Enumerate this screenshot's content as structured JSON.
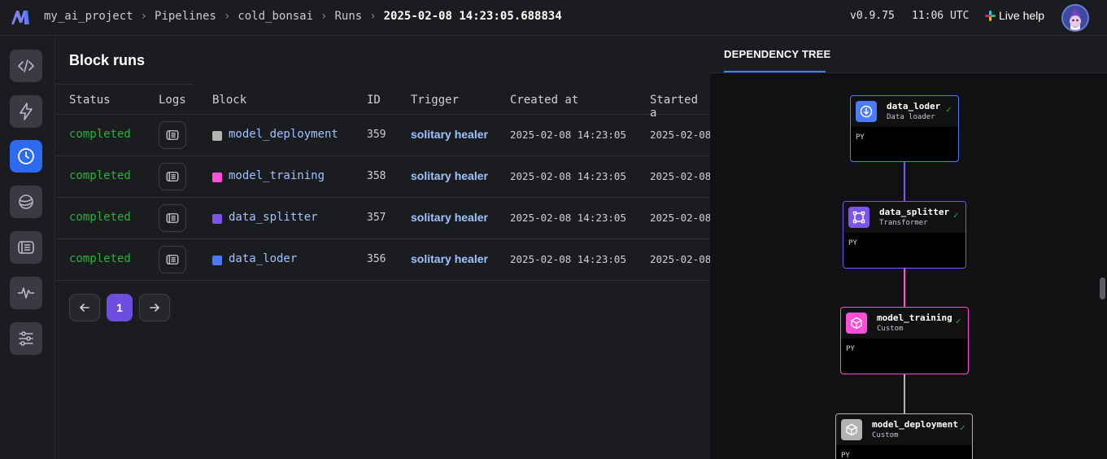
{
  "header": {
    "breadcrumbs": [
      "my_ai_project",
      "Pipelines",
      "cold_bonsai",
      "Runs"
    ],
    "current": "2025-02-08 14:23:05.688834",
    "version": "v0.9.75",
    "time": "11:06 UTC",
    "live_help": "Live help"
  },
  "nav": {
    "items": [
      "code-icon",
      "bolt-icon",
      "clock-icon",
      "planet-icon",
      "logs-icon",
      "heartbeat-icon",
      "sliders-icon"
    ],
    "active": "clock-icon"
  },
  "main": {
    "title": "Block runs",
    "columns": [
      "Status",
      "Logs",
      "Block",
      "ID",
      "Trigger",
      "Created at",
      "Started a"
    ],
    "rows": [
      {
        "status": "completed",
        "block": "model_deployment",
        "color": "#b3b3b3",
        "id": "359",
        "trigger": "solitary healer",
        "created_at": "2025-02-08 14:23:05",
        "started_at": "2025-02-08"
      },
      {
        "status": "completed",
        "block": "model_training",
        "color": "#ff4fd8",
        "id": "358",
        "trigger": "solitary healer",
        "created_at": "2025-02-08 14:23:05",
        "started_at": "2025-02-08"
      },
      {
        "status": "completed",
        "block": "data_splitter",
        "color": "#7d55ec",
        "id": "357",
        "trigger": "solitary healer",
        "created_at": "2025-02-08 14:23:05",
        "started_at": "2025-02-08"
      },
      {
        "status": "completed",
        "block": "data_loder",
        "color": "#4c7cf5",
        "id": "356",
        "trigger": "solitary healer",
        "created_at": "2025-02-08 14:23:05",
        "started_at": "2025-02-08"
      }
    ],
    "pagination": {
      "page": "1"
    }
  },
  "dependency_tree": {
    "tab": "DEPENDENCY TREE",
    "nodes": [
      {
        "name": "data_loder",
        "type": "Data loader",
        "lang": "PY",
        "color": "#4c7cf5",
        "icon": "download-icon"
      },
      {
        "name": "data_splitter",
        "type": "Transformer",
        "lang": "PY",
        "color": "#7d55ec",
        "icon": "transform-icon"
      },
      {
        "name": "model_training",
        "type": "Custom",
        "lang": "PY",
        "color": "#ff4fd8",
        "icon": "cube-icon"
      },
      {
        "name": "model_deployment",
        "type": "Custom",
        "lang": "PY",
        "color": "#b3b3b3",
        "icon": "cube-icon"
      }
    ]
  },
  "colors": {
    "accent": "#2f6bf2",
    "success": "#27b338",
    "link": "#9ec3ff",
    "page_active": "#6e4ee0"
  }
}
